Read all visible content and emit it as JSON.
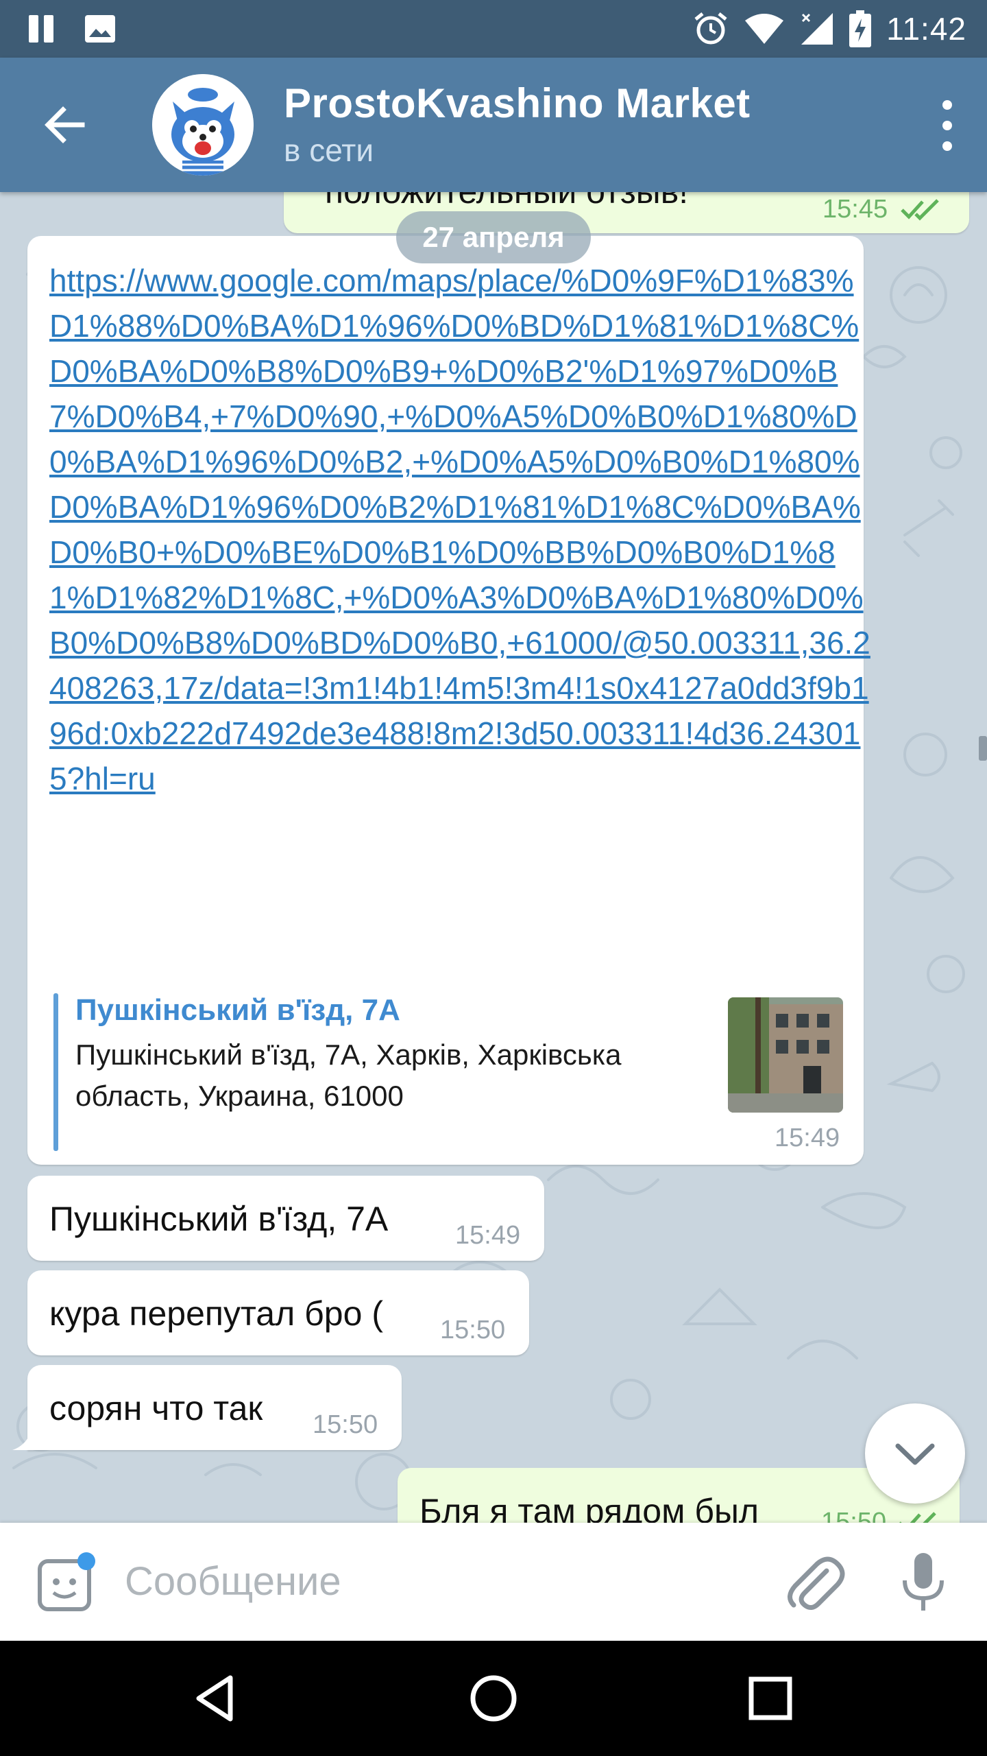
{
  "status_bar": {
    "time": "11:42",
    "icons": [
      "pause-icon",
      "image-icon",
      "alarm-icon",
      "wifi-icon",
      "signal-icon",
      "battery-charging-icon"
    ]
  },
  "header": {
    "back_icon": "arrow-left-icon",
    "title": "ProstoKvashino Market",
    "status": "в сети",
    "menu_icon": "more-vertical-icon"
  },
  "chat": {
    "date": "27 апреля",
    "messages": [
      {
        "direction": "out",
        "text": "положительный отзыв!",
        "time": "15:45",
        "read": true
      },
      {
        "direction": "in",
        "link": "https://www.google.com/maps/place/%D0%9F%D1%83%D1%88%D0%BA%D1%96%D0%BD%D1%81%D1%8C%D0%BA%D0%B8%D0%B9+%D0%B2'%D1%97%D0%B7%D0%B4,+7%D0%90,+%D0%A5%D0%B0%D1%80%D0%BA%D1%96%D0%B2,+%D0%A5%D0%B0%D1%80%D0%BA%D1%96%D0%B2%D1%81%D1%8C%D0%BA%D0%B0+%D0%BE%D0%B1%D0%BB%D0%B0%D1%81%D1%82%D1%8C,+%D0%A3%D0%BA%D1%80%D0%B0%D0%B8%D0%BD%D0%B0,+61000/@50.003311,36.2408263,17z/data=!3m1!4b1!4m5!3m4!1s0x4127a0dd3f9b196d:0xb222d7492de3e488!8m2!3d50.003311!4d36.243015?hl=ru",
        "preview_title": "Пушкінський в'їзд, 7А",
        "preview_description": "Пушкінський в'їзд, 7А, Харків, Харківська область, Украина, 61000",
        "time": "15:49"
      },
      {
        "direction": "in",
        "text": "Пушкінський в'їзд, 7А",
        "time": "15:49"
      },
      {
        "direction": "in",
        "text": "кура перепутал бро (",
        "time": "15:50"
      },
      {
        "direction": "in",
        "text": "сорян что так",
        "time": "15:50"
      },
      {
        "direction": "out",
        "text": "Бля я там рядом был",
        "time": "15:50",
        "read": true
      }
    ]
  },
  "input_bar": {
    "emoji_icon": "sticker-emoji-icon",
    "placeholder": "Сообщение",
    "attach_icon": "paperclip-icon",
    "mic_icon": "microphone-icon"
  },
  "nav_bar": {
    "icons": [
      "back-triangle-icon",
      "home-circle-icon",
      "recents-square-icon"
    ]
  },
  "colors": {
    "header": "#527da3",
    "status_bar": "#3e5c75",
    "link": "#2a7bc0",
    "outgoing_bubble": "#effdde",
    "chat_background": "#c9d5de"
  }
}
